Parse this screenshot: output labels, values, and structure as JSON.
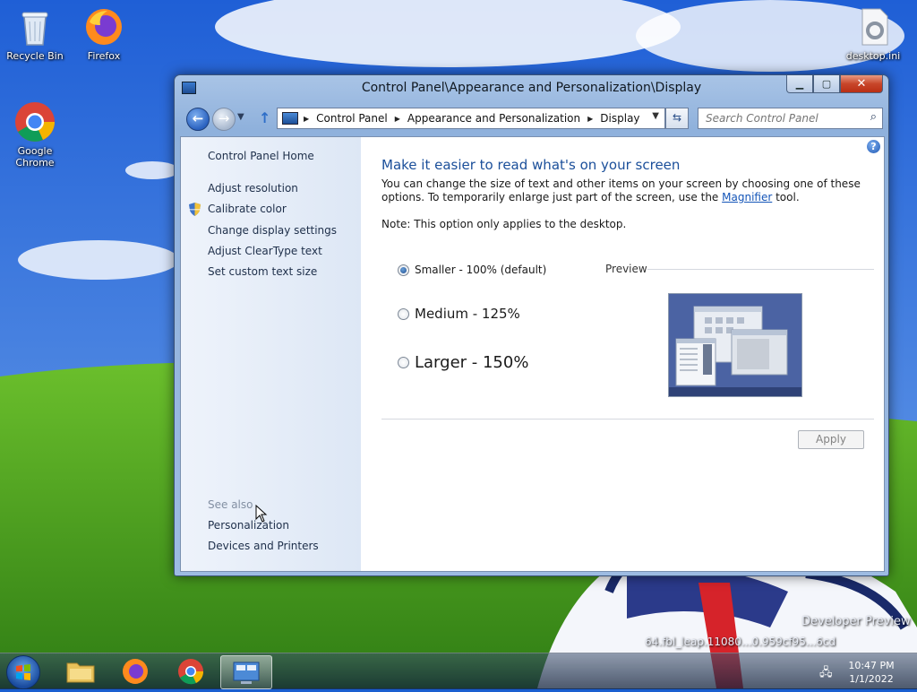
{
  "desktop": {
    "icons": [
      {
        "label": "Recycle Bin"
      },
      {
        "label": "Firefox"
      },
      {
        "label": "Google Chrome"
      },
      {
        "label": "desktop.ini"
      }
    ],
    "watermark_line1": "Developer Preview",
    "watermark_line2": "64.fbl_leap.11080...0.959cf95...6cd"
  },
  "window": {
    "title": "Control Panel\\Appearance and Personalization\\Display",
    "address_crumbs": [
      "Control Panel",
      "Appearance and Personalization",
      "Display"
    ],
    "search_placeholder": "Search Control Panel"
  },
  "left_pane": {
    "home": "Control Panel Home",
    "tasks": [
      "Adjust resolution",
      "Calibrate color",
      "Change display settings",
      "Adjust ClearType text",
      "Set custom text size"
    ],
    "see_also_label": "See also",
    "see_also": [
      "Personalization",
      "Devices and Printers"
    ]
  },
  "main": {
    "heading": "Make it easier to read what's on your screen",
    "desc_before": "You can change the size of text and other items on your screen by choosing one of these options. To temporarily enlarge just part of the screen, use the ",
    "desc_link": "Magnifier",
    "desc_after": " tool.",
    "note": "Note: This option only applies to the desktop.",
    "options": [
      {
        "label": "Smaller - 100% (default)",
        "selected": true
      },
      {
        "label": "Medium - 125%",
        "selected": false
      },
      {
        "label": "Larger - 150%",
        "selected": false
      }
    ],
    "preview_label": "Preview",
    "apply_label": "Apply"
  },
  "taskbar": {
    "time": "10:47 PM",
    "date": "1/1/2022"
  },
  "colors": {
    "heading_blue": "#1b4f9a",
    "link_blue": "#1455b8",
    "close_red": "#c8462a"
  }
}
